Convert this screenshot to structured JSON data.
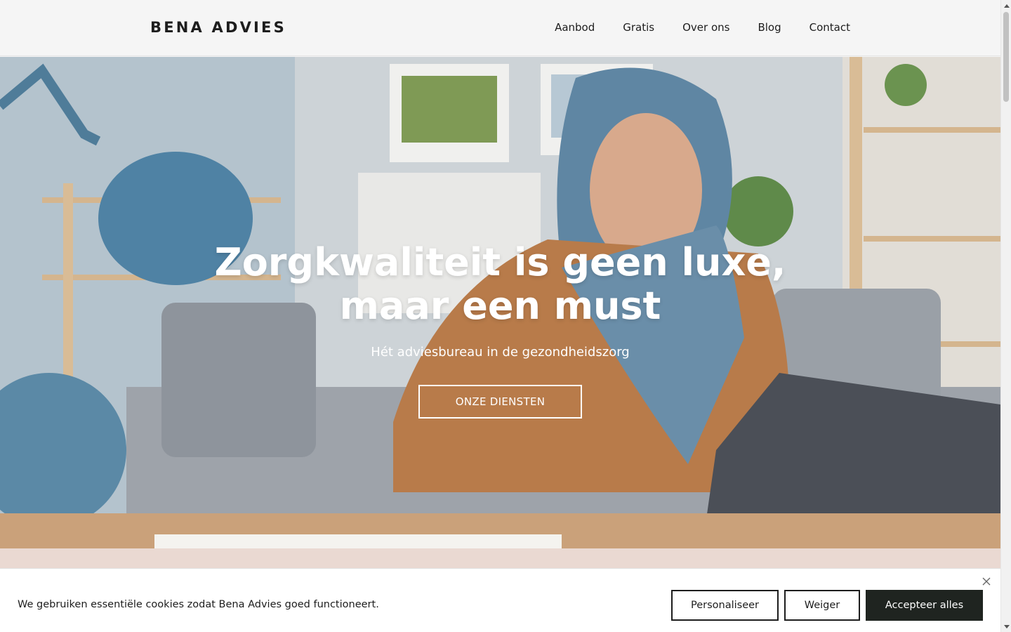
{
  "header": {
    "logo": "BENA ADVIES",
    "nav": [
      {
        "label": "Aanbod"
      },
      {
        "label": "Gratis"
      },
      {
        "label": "Over ons"
      },
      {
        "label": "Blog"
      },
      {
        "label": "Contact"
      }
    ]
  },
  "hero": {
    "title_line1": "Zorgkwaliteit is geen luxe,",
    "title_line2": "maar een must",
    "subtitle": "Hét adviesbureau in de gezondheidszorg",
    "button_label": "ONZE DIENSTEN"
  },
  "cookie": {
    "text": "We gebruiken essentiële cookies zodat Bena Advies goed functioneert.",
    "personalise_label": "Personaliseer",
    "decline_label": "Weiger",
    "accept_label": "Accepteer alles",
    "close_icon": "close-icon"
  },
  "colors": {
    "header_bg": "#f5f5f5",
    "band": "#ead9d2",
    "accept_bg": "#1f2420",
    "text_dark": "#1d1d1d"
  }
}
